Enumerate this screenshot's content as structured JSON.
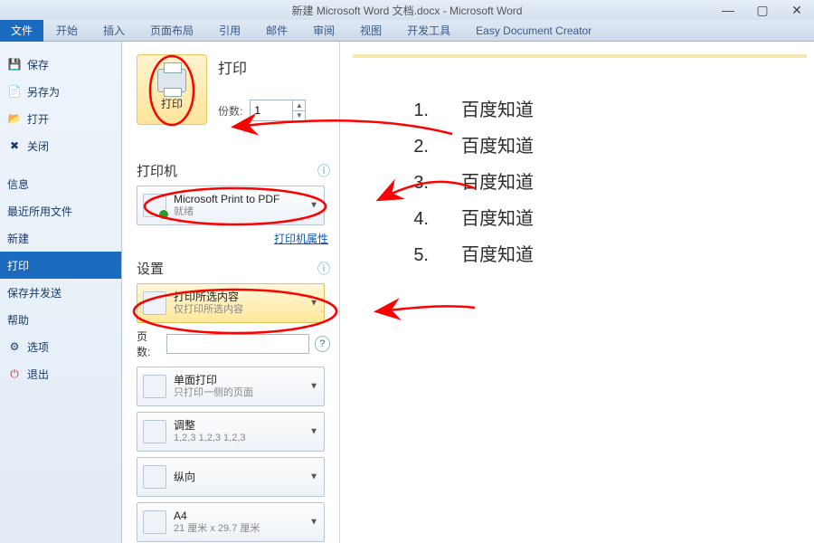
{
  "title": "新建 Microsoft Word 文档.docx - Microsoft Word",
  "ribbon": {
    "file": "文件",
    "tabs": [
      "开始",
      "插入",
      "页面布局",
      "引用",
      "邮件",
      "审阅",
      "视图",
      "开发工具",
      "Easy Document Creator"
    ]
  },
  "nav": {
    "save": "保存",
    "saveAs": "另存为",
    "open": "打开",
    "close": "关闭",
    "info": "信息",
    "recent": "最近所用文件",
    "new": "新建",
    "print": "打印",
    "saveSend": "保存并发送",
    "help": "帮助",
    "options": "选项",
    "exit": "退出"
  },
  "print": {
    "title": "打印",
    "btn": "打印",
    "copiesLabel": "份数:",
    "copies": "1",
    "printerHeader": "打印机",
    "printerName": "Microsoft Print to PDF",
    "printerStatus": "就绪",
    "printerProps": "打印机属性",
    "settingsHeader": "设置",
    "scope": {
      "t": "打印所选内容",
      "s": "仅打印所选内容"
    },
    "pagesLabel": "页数:",
    "side": {
      "t": "单面打印",
      "s": "只打印一侧的页面"
    },
    "collate": {
      "t": "调整",
      "s": "1,2,3    1,2,3    1,2,3"
    },
    "orient": {
      "t": "纵向",
      "s": ""
    },
    "paper": {
      "t": "A4",
      "s": "21 厘米 x 29.7 厘米"
    }
  },
  "doc": {
    "items": [
      {
        "n": "1.",
        "t": "百度知道"
      },
      {
        "n": "2.",
        "t": "百度知道"
      },
      {
        "n": "3.",
        "t": "百度知道"
      },
      {
        "n": "4.",
        "t": "百度知道"
      },
      {
        "n": "5.",
        "t": "百度知道"
      }
    ]
  },
  "annot": {
    "stroke": "#ff0000"
  }
}
